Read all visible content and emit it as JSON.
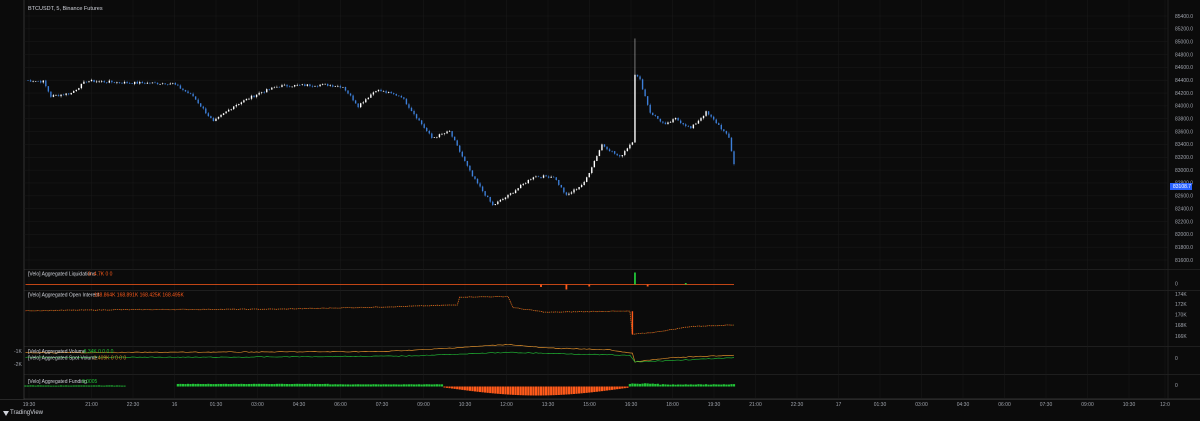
{
  "symbol_title": "BTCUSDT, 5, Binance Futures",
  "brand": "TradingView",
  "colors": {
    "up": "#ffffff",
    "down": "#3d7fd9",
    "green": "#22c538",
    "red": "#ff5a1a",
    "orange": "#d88b2a",
    "last_price_bg": "#2962ff",
    "grid": "#1a1a1a"
  },
  "time_axis": [
    "19:30",
    "21:00",
    "22:30",
    "16",
    "01:30",
    "03:00",
    "04:30",
    "06:00",
    "07:30",
    "09:00",
    "10:30",
    "12:00",
    "13:30",
    "15:00",
    "16:30",
    "18:00",
    "19:30",
    "21:00",
    "22:30",
    "17",
    "01:30",
    "03:00",
    "04:30",
    "06:00",
    "07:30",
    "09:00",
    "10:30",
    "12:0"
  ],
  "price_axis": [
    "85400.0",
    "85200.0",
    "85000.0",
    "84800.0",
    "84600.0",
    "84400.0",
    "84200.0",
    "84000.0",
    "83800.0",
    "83600.0",
    "83400.0",
    "83200.0",
    "83000.0",
    "82800.0",
    "82600.0",
    "82400.0",
    "82200.0",
    "82000.0",
    "81800.0",
    "81600.0"
  ],
  "last_price": "83108.7",
  "panes": {
    "liquidations": {
      "legend": "[Velo] Aggregated Liquidations",
      "values": "0  -4.7K  0  0",
      "axis": [
        "0"
      ]
    },
    "open_interest": {
      "legend": "[Velo] Aggregated Open Interest",
      "values": "168.864K  168.891K  168.425K  168.495K",
      "axis": [
        "174K",
        "172K",
        "170K",
        "168K",
        "166K"
      ]
    },
    "volume": {
      "legend1": "[Velo] Aggregated Volume",
      "values1": "-3.34K  0  0  0  0",
      "legend2": "[Velo] Aggregated Spot Volume",
      "values2": "-1.409K  0  0  0  0",
      "left_labels": [
        "-1K",
        "-2K"
      ],
      "axis": [
        "0"
      ]
    },
    "funding": {
      "legend": "[Velo] Aggregated Funding",
      "values": "0.0005",
      "axis": [
        "0"
      ]
    }
  },
  "chart_data": {
    "type": "candlestick",
    "title": "BTCUSDT, 5, Binance Futures",
    "ylim": [
      81500,
      85500
    ],
    "last_price": 83108.7,
    "x_range": [
      "19:30",
      "12:0"
    ],
    "price_path_keypoints": [
      {
        "t": 0,
        "p": 84400
      },
      {
        "t": 7,
        "p": 84380
      },
      {
        "t": 10,
        "p": 84150
      },
      {
        "t": 18,
        "p": 84200
      },
      {
        "t": 24,
        "p": 84390
      },
      {
        "t": 40,
        "p": 84360
      },
      {
        "t": 58,
        "p": 84350
      },
      {
        "t": 66,
        "p": 84150
      },
      {
        "t": 74,
        "p": 83750
      },
      {
        "t": 82,
        "p": 84000
      },
      {
        "t": 92,
        "p": 84200
      },
      {
        "t": 100,
        "p": 84310
      },
      {
        "t": 118,
        "p": 84330
      },
      {
        "t": 125,
        "p": 84300
      },
      {
        "t": 131,
        "p": 84000
      },
      {
        "t": 138,
        "p": 84250
      },
      {
        "t": 148,
        "p": 84150
      },
      {
        "t": 160,
        "p": 83500
      },
      {
        "t": 167,
        "p": 83600
      },
      {
        "t": 176,
        "p": 82900
      },
      {
        "t": 184,
        "p": 82450
      },
      {
        "t": 190,
        "p": 82600
      },
      {
        "t": 200,
        "p": 82900
      },
      {
        "t": 208,
        "p": 82900
      },
      {
        "t": 213,
        "p": 82600
      },
      {
        "t": 220,
        "p": 82800
      },
      {
        "t": 227,
        "p": 83400
      },
      {
        "t": 234,
        "p": 83200
      },
      {
        "t": 239,
        "p": 83450
      },
      {
        "t": 240,
        "p": 84500
      },
      {
        "t": 242,
        "p": 84400
      },
      {
        "t": 246,
        "p": 83900
      },
      {
        "t": 252,
        "p": 83700
      },
      {
        "t": 256,
        "p": 83800
      },
      {
        "t": 262,
        "p": 83650
      },
      {
        "t": 268,
        "p": 83900
      },
      {
        "t": 273,
        "p": 83700
      },
      {
        "t": 277,
        "p": 83500
      },
      {
        "t": 279,
        "p": 83100
      }
    ],
    "spike_high": 85050,
    "bars": 280,
    "series": [
      {
        "name": "[Velo] Aggregated Liquidations",
        "last": 0
      },
      {
        "name": "[Velo] Aggregated Open Interest",
        "last": 168495
      },
      {
        "name": "[Velo] Aggregated Volume",
        "last": -3340
      },
      {
        "name": "[Velo] Aggregated Spot Volume",
        "last": -1409
      },
      {
        "name": "[Velo] Aggregated Funding",
        "last": 0.0005
      }
    ]
  }
}
